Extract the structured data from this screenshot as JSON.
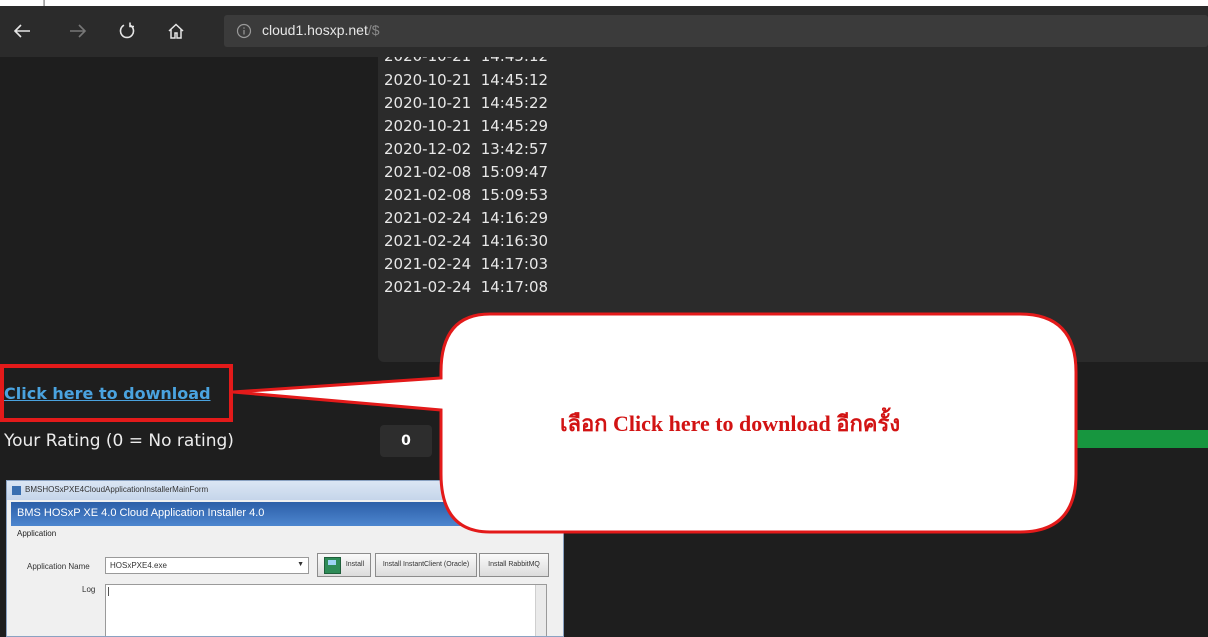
{
  "browser": {
    "url_host": "cloud1.hosxp.net",
    "url_rest": "/$"
  },
  "log": {
    "partial_line": "2020-10-21  14:45:12",
    "lines": [
      "2020-10-21  14:45:12",
      "2020-10-21  14:45:22",
      "2020-10-21  14:45:29",
      "2020-12-02  13:42:57",
      "2021-02-08  15:09:47",
      "2021-02-08  15:09:53",
      "2021-02-24  14:16:29",
      "2021-02-24  14:16:30",
      "2021-02-24  14:17:03",
      "2021-02-24  14:17:08"
    ]
  },
  "download": {
    "link_text": "Click here to download"
  },
  "rating": {
    "label": "Your Rating (0 = No rating)",
    "value": "0"
  },
  "callout": {
    "text": "เลือก Click here to download อีกครั้ง",
    "border_color": "#e31a1a",
    "text_color": "#d21313"
  },
  "installer": {
    "window_title": "BMSHOSxPXE4CloudApplicationInstallerMainForm",
    "header": "BMS HOSxP XE 4.0 Cloud Application Installer 4.0",
    "group_label": "Application",
    "app_name_label": "Application Name",
    "app_name_value": "HOSxPXE4.exe",
    "install_button": "Install",
    "install_oracle_button": "Install InstantClient (Oracle)",
    "install_rabbit_button": "Install RabbitMQ",
    "log_label": "Log"
  },
  "colors": {
    "accent_link": "#4aa3df",
    "rating_bar": "#17963f",
    "page_bg": "#1e1e1e"
  }
}
